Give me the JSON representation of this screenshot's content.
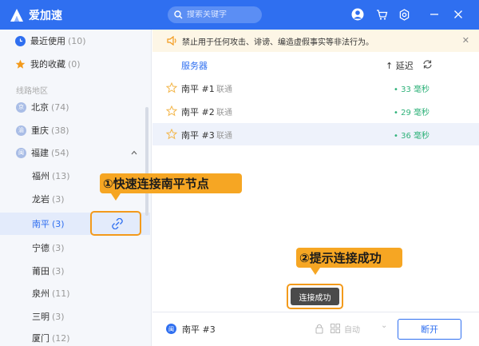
{
  "app": {
    "name": "爱加速"
  },
  "search": {
    "placeholder": "搜索关键字"
  },
  "colors": {
    "brand": "#2f6ff0",
    "latency_good": "#2fb27a",
    "annotation": "#f6a623",
    "notice_bg": "#fdf6e6"
  },
  "icons": {
    "titlebar": [
      "user-avatar-icon",
      "cart-icon",
      "gear-icon",
      "minimize-icon",
      "close-icon"
    ]
  },
  "sidebar": {
    "recent": {
      "label": "最近使用",
      "count": "(10)"
    },
    "favorites": {
      "label": "我的收藏",
      "count": "(0)"
    },
    "section_label": "线路地区",
    "regions": [
      {
        "badge": "京",
        "label": "北京",
        "count": "(74)"
      },
      {
        "badge": "渝",
        "label": "重庆",
        "count": "(38)"
      },
      {
        "badge": "闽",
        "label": "福建",
        "count": "(54)"
      }
    ],
    "cities": [
      {
        "label": "福州",
        "count": "(13)"
      },
      {
        "label": "龙岩",
        "count": "(3)"
      },
      {
        "label": "南平",
        "count": "(3)"
      },
      {
        "label": "宁德",
        "count": "(3)"
      },
      {
        "label": "莆田",
        "count": "(3)"
      },
      {
        "label": "泉州",
        "count": "(11)"
      },
      {
        "label": "三明",
        "count": "(3)"
      },
      {
        "label": "厦门",
        "count": "(12)"
      }
    ]
  },
  "notice": {
    "text": "禁止用于任何攻击、诽谤、编造虚假事实等非法行为。",
    "close": "✕"
  },
  "table": {
    "col_server": "服务器",
    "col_latency": "延迟",
    "rows": [
      {
        "name": "南平 #1",
        "isp": "联通",
        "latency": "33 毫秒"
      },
      {
        "name": "南平 #2",
        "isp": "联通",
        "latency": "29 毫秒"
      },
      {
        "name": "南平 #3",
        "isp": "联通",
        "latency": "36 毫秒"
      }
    ]
  },
  "bottom": {
    "current_badge": "闽",
    "current": "南平 #3",
    "mode": "自动",
    "disconnect": "断开"
  },
  "annotations": {
    "step1": "①快速连接南平节点",
    "step2": "②提示连接成功"
  },
  "toast": "连接成功"
}
